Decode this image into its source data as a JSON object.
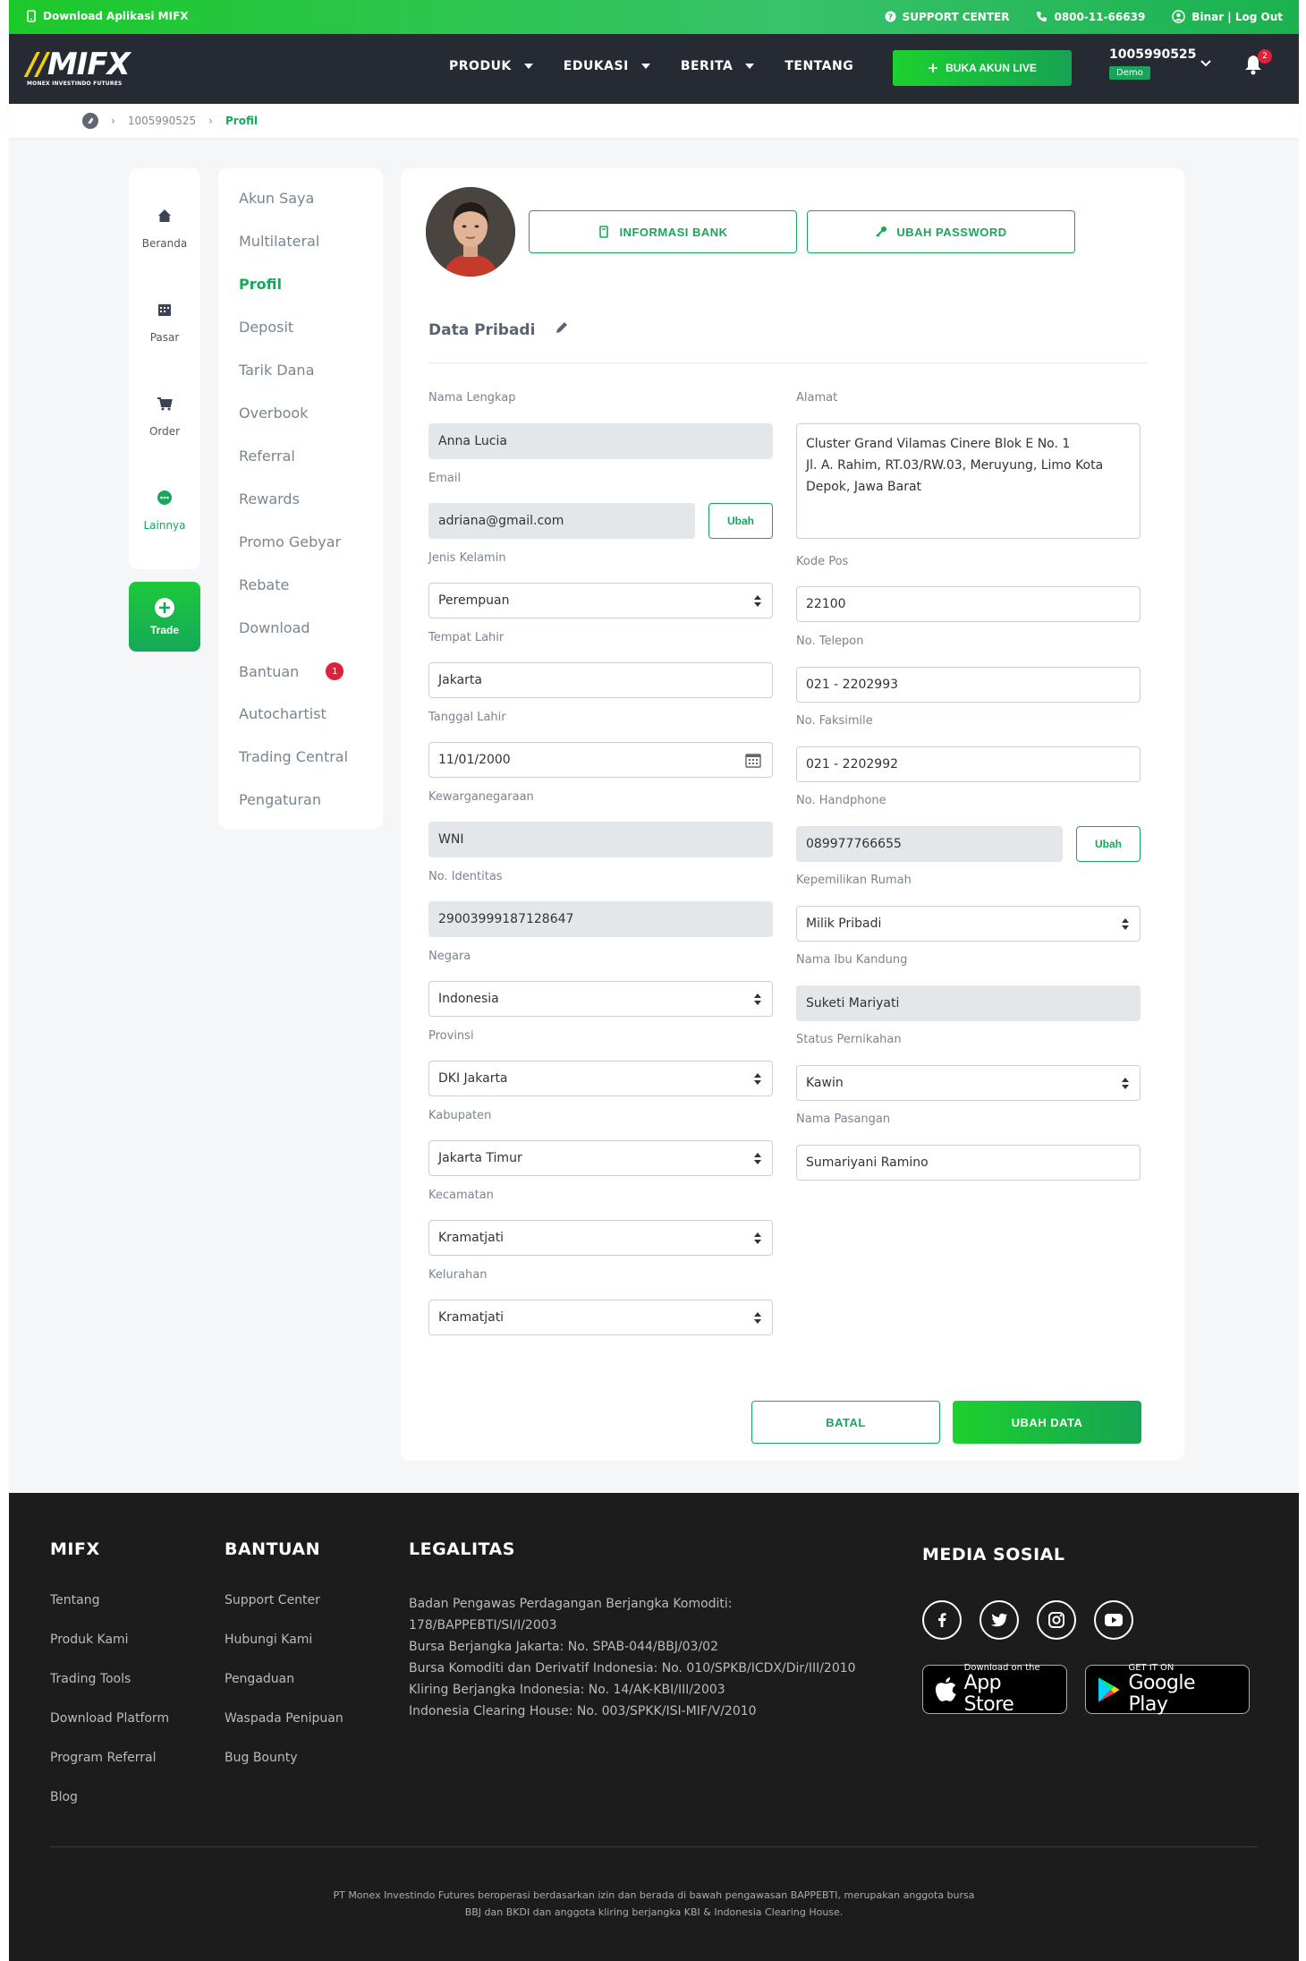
{
  "topbar": {
    "download": "Download Aplikasi MIFX",
    "support": "SUPPORT CENTER",
    "phone": "0800-11-66639",
    "user": "Binar | Log Out"
  },
  "nav": {
    "logo": "MIFX",
    "logo_sub": "MONEX INVESTINDO FUTURES",
    "menu": [
      "PRODUK",
      "EDUKASI",
      "BERITA",
      "TENTANG"
    ],
    "live_button": "BUKA AKUN LIVE",
    "account_number": "1005990525",
    "account_type": "Demo",
    "notif_count": "2"
  },
  "breadcrumb": {
    "items": [
      "1005990525",
      "Profil"
    ]
  },
  "iconbar": {
    "items": [
      {
        "label": "Beranda",
        "icon": "home-icon"
      },
      {
        "label": "Pasar",
        "icon": "market-icon"
      },
      {
        "label": "Order",
        "icon": "cart-icon"
      },
      {
        "label": "Lainnya",
        "icon": "more-icon"
      }
    ],
    "trade": "Trade"
  },
  "menu": {
    "items": [
      "Akun Saya",
      "Multilateral",
      "Profil",
      "Deposit",
      "Tarik Dana",
      "Overbook",
      "Referral",
      "Rewards",
      "Promo Gebyar",
      "Rebate",
      "Download",
      "Bantuan",
      "Autochartist",
      "Trading Central",
      "Pengaturan"
    ],
    "bantuan_badge": "1"
  },
  "profile": {
    "bank_button": "INFORMASI BANK",
    "password_button": "UBAH PASSWORD",
    "section_title": "Data Pribadi",
    "ubah_label": "Ubah",
    "left": {
      "nama_label": "Nama Lengkap",
      "nama": "Anna Lucia",
      "email_label": "Email",
      "email": "adriana@gmail.com",
      "jk_label": "Jenis Kelamin",
      "jk": "Perempuan",
      "tempat_label": "Tempat Lahir",
      "tempat": "Jakarta",
      "tgl_label": "Tanggal Lahir",
      "tgl": "11/01/2000",
      "warga_label": "Kewarganegaraan",
      "warga": "WNI",
      "id_label": "No. Identitas",
      "id": "29003999187128647",
      "negara_label": "Negara",
      "negara": "Indonesia",
      "prov_label": "Provinsi",
      "prov": "DKI Jakarta",
      "kab_label": "Kabupaten",
      "kab": "Jakarta Timur",
      "kec_label": "Kecamatan",
      "kec": "Kramatjati",
      "kel_label": "Kelurahan",
      "kel": "Kramatjati"
    },
    "right": {
      "alamat_label": "Alamat",
      "alamat_1": "Cluster Grand Vilamas Cinere Blok E No. 1",
      "alamat_2": "Jl. A. Rahim, RT.03/RW.03, Meruyung, Limo Kota",
      "alamat_3": "Depok, Jawa Barat",
      "pos_label": "Kode Pos",
      "pos": "22100",
      "telp_label": "No. Telepon",
      "telp": "021 - 2202993",
      "fax_label": "No. Faksimile",
      "fax": "021 - 2202992",
      "hp_label": "No. Handphone",
      "hp": "089977766655",
      "rumah_label": "Kepemilikan Rumah",
      "rumah": "Milik Pribadi",
      "ibu_label": "Nama Ibu Kandung",
      "ibu": "Suketi Mariyati",
      "nikah_label": "Status Pernikahan",
      "nikah": "Kawin",
      "pasangan_label": "Nama Pasangan",
      "pasangan": "Sumariyani Ramino"
    },
    "batal": "BATAL",
    "ubah_data": "UBAH DATA"
  },
  "footer": {
    "mifx": {
      "title": "MIFX",
      "links": [
        "Tentang",
        "Produk Kami",
        "Trading Tools",
        "Download Platform",
        "Program Referral",
        "Blog"
      ]
    },
    "bantuan": {
      "title": "BANTUAN",
      "links": [
        "Support Center",
        "Hubungi Kami",
        "Pengaduan",
        "Waspada Penipuan",
        "Bug Bounty"
      ]
    },
    "legalitas": {
      "title": "LEGALITAS",
      "lines": [
        "Badan Pengawas Perdagangan Berjangka Komoditi:",
        "178/BAPPEBTI/SI/I/2003",
        "Bursa Berjangka Jakarta: No. SPAB-044/BBJ/03/02",
        "Bursa Komoditi dan Derivatif Indonesia: No. 010/SPKB/ICDX/Dir/III/2010",
        "Kliring Berjangka Indonesia: No. 14/AK-KBI/III/2003",
        "Indonesia Clearing House: No. 003/SPKK/ISI-MIF/V/2010"
      ]
    },
    "media": {
      "title": "MEDIA SOSIAL"
    },
    "appstore_top": "Download on the",
    "appstore": "App Store",
    "gplay_top": "GET IT ON",
    "gplay": "Google Play",
    "note_1": "PT Monex Investindo Futures beroperasi berdasarkan izin dan berada di bawah pengawasan BAPPEBTI, merupakan anggota bursa",
    "note_2": "BBJ dan BKDI dan anggota kliring berjangka KBI & Indonesia Clearing House."
  },
  "colors": {
    "accent": "#16a85a",
    "nav_bg": "#262b33",
    "footer_bg": "#1c1c1c",
    "badge_red": "#e0203a"
  }
}
